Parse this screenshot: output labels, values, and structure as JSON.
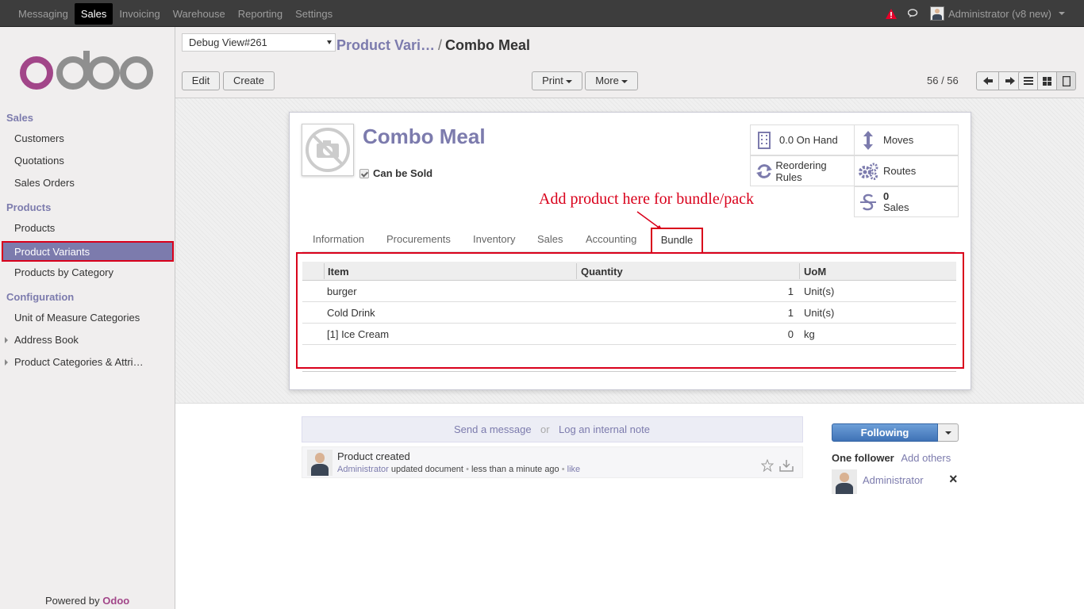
{
  "topbar": {
    "menu": [
      "Messaging",
      "Sales",
      "Invoicing",
      "Warehouse",
      "Reporting",
      "Settings"
    ],
    "active_menu": "Sales",
    "user": "Administrator (v8  new)"
  },
  "sidebar": {
    "sections": [
      {
        "title": "Sales",
        "items": [
          "Customers",
          "Quotations",
          "Sales Orders"
        ]
      },
      {
        "title": "Products",
        "items": [
          "Products",
          "Product Variants",
          "Products by Category"
        ]
      },
      {
        "title": "Configuration",
        "items": [
          "Unit of Measure Categories",
          "Address Book",
          "Product Categories & Attri…"
        ]
      }
    ],
    "selected_item": "Product Variants",
    "powered_prefix": "Powered by",
    "powered_brand": "Odoo"
  },
  "control_panel": {
    "debug_view": "Debug View#261",
    "breadcrumb_parent": "Product Vari…",
    "breadcrumb_sep": "/",
    "breadcrumb_current": "Combo Meal",
    "edit_label": "Edit",
    "create_label": "Create",
    "print_label": "Print",
    "more_label": "More",
    "pager": "56 / 56"
  },
  "form": {
    "product_name": "Combo Meal",
    "can_be_sold_label": "Can be Sold",
    "smart_buttons": {
      "on_hand": "0.0 On Hand",
      "moves": "Moves",
      "reordering": "Reordering Rules",
      "routes": "Routes",
      "sales_count": "0",
      "sales_label": "Sales"
    },
    "annotation": "Add product here for bundle/pack",
    "tabs": [
      "Information",
      "Procurements",
      "Inventory",
      "Sales",
      "Accounting",
      "Bundle"
    ],
    "active_tab": "Bundle",
    "bundle_table": {
      "headers": [
        "Item",
        "Quantity",
        "UoM"
      ],
      "rows": [
        {
          "item": "burger",
          "quantity": "1",
          "uom": "Unit(s)"
        },
        {
          "item": "Cold Drink",
          "quantity": "1",
          "uom": "Unit(s)"
        },
        {
          "item": "[1] Ice Cream",
          "quantity": "0",
          "uom": "kg"
        }
      ]
    }
  },
  "chatter": {
    "send_message": "Send a message",
    "or": "or",
    "log_note": "Log an internal note",
    "message_title": "Product created",
    "message_author": "Administrator",
    "message_action": "updated document",
    "message_time": "less than a minute ago",
    "message_like": "like",
    "following_label": "Following",
    "followers_count_label": "One follower",
    "add_others_label": "Add others",
    "follower_name": "Administrator",
    "remove_glyph": "×"
  },
  "colors": {
    "accent": "#7c7bad",
    "highlight_border": "#d9001b",
    "topbar": "#3d3d3d",
    "brand": "#a24689"
  }
}
